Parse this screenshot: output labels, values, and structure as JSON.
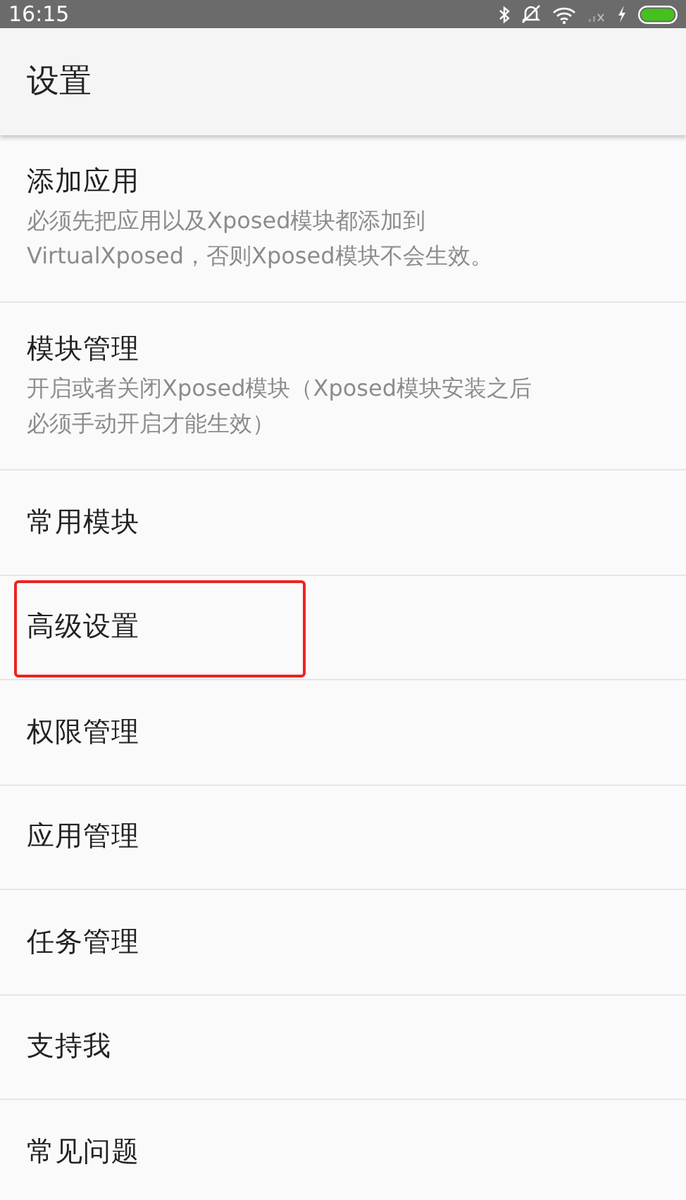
{
  "status_bar": {
    "time": "16:15"
  },
  "app_bar": {
    "title": "设置"
  },
  "items": [
    {
      "title": "添加应用",
      "description": "必须先把应用以及Xposed模块都添加到VirtualXposed，否则Xposed模块不会生效。",
      "highlighted": false
    },
    {
      "title": "模块管理",
      "description": "开启或者关闭Xposed模块（Xposed模块安装之后必须手动开启才能生效）",
      "highlighted": false
    },
    {
      "title": "常用模块",
      "highlighted": false
    },
    {
      "title": "高级设置",
      "highlighted": true
    },
    {
      "title": "权限管理",
      "highlighted": false
    },
    {
      "title": "应用管理",
      "highlighted": false
    },
    {
      "title": "任务管理",
      "highlighted": false
    },
    {
      "title": "支持我",
      "highlighted": false
    },
    {
      "title": "常见问题",
      "highlighted": false
    }
  ]
}
